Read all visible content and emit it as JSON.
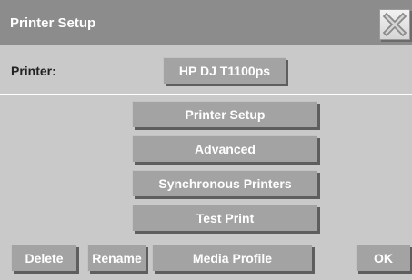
{
  "window": {
    "title": "Printer Setup"
  },
  "icons": {
    "close": "close-x-icon"
  },
  "printer": {
    "label": "Printer:",
    "selected": "HP DJ T1100ps"
  },
  "actions": {
    "printer_setup": "Printer Setup",
    "advanced": "Advanced",
    "synchronous_printers": "Synchronous Printers",
    "test_print": "Test Print"
  },
  "footer": {
    "delete": "Delete",
    "rename": "Rename",
    "media_profile": "Media Profile",
    "ok": "OK"
  },
  "colors": {
    "titlebar": "#8c8c8c",
    "panel": "#c9c9c9",
    "button": "#a3a3a3",
    "button_shadow": "#5e5e5e"
  }
}
